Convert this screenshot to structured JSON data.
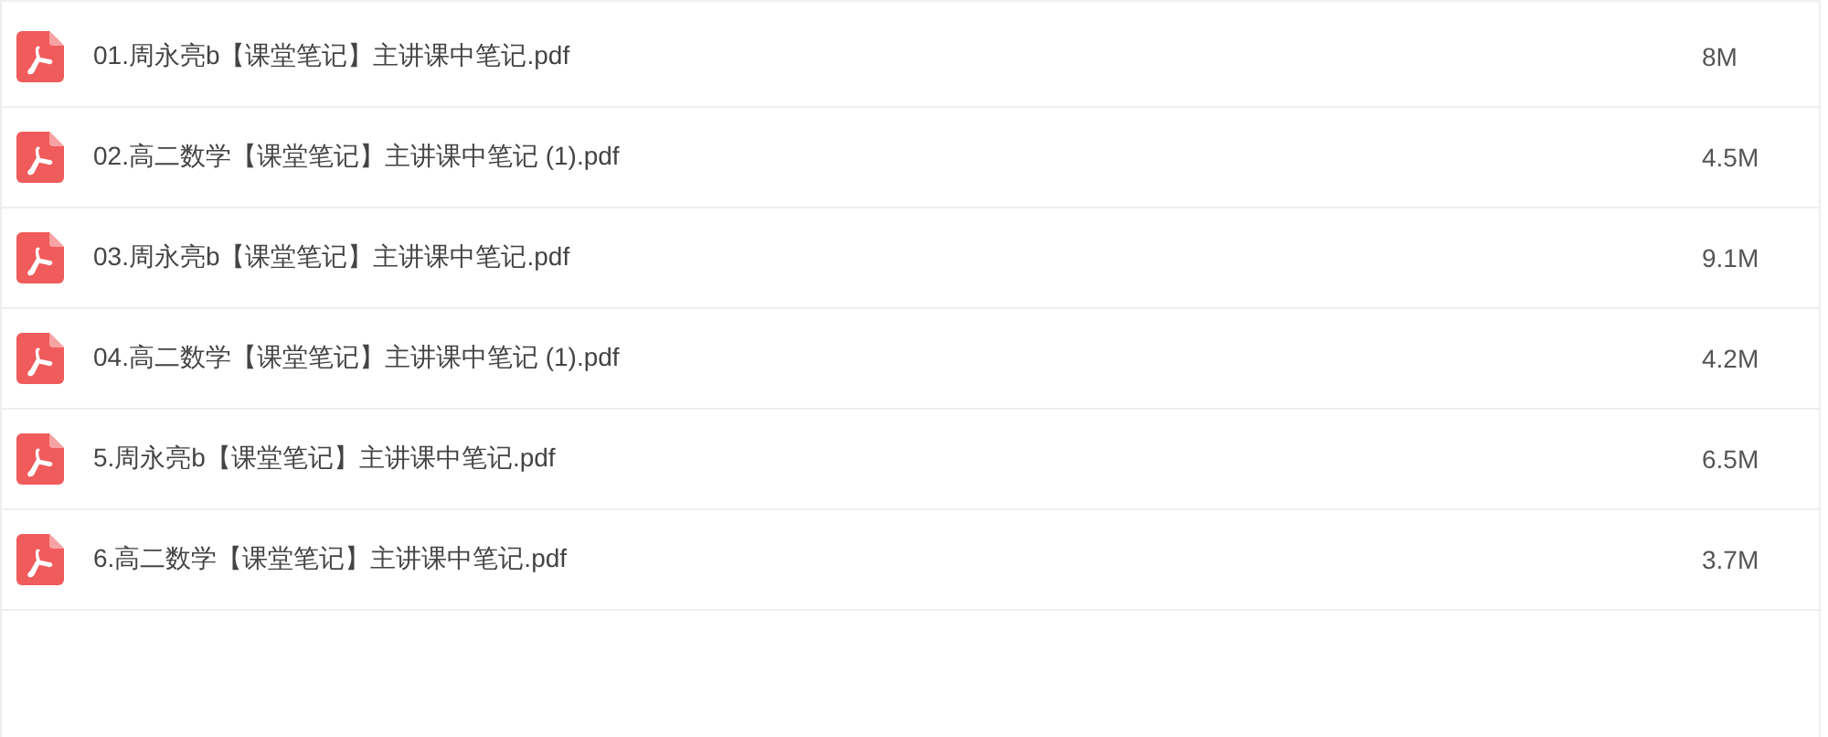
{
  "files": [
    {
      "name": "01.周永亮b【课堂笔记】主讲课中笔记.pdf",
      "size": "8M",
      "kind": "pdf"
    },
    {
      "name": "02.高二数学【课堂笔记】主讲课中笔记 (1).pdf",
      "size": "4.5M",
      "kind": "pdf"
    },
    {
      "name": "03.周永亮b【课堂笔记】主讲课中笔记.pdf",
      "size": "9.1M",
      "kind": "pdf"
    },
    {
      "name": "04.高二数学【课堂笔记】主讲课中笔记 (1).pdf",
      "size": "4.2M",
      "kind": "pdf"
    },
    {
      "name": "5.周永亮b【课堂笔记】主讲课中笔记.pdf",
      "size": "6.5M",
      "kind": "pdf"
    },
    {
      "name": "6.高二数学【课堂笔记】主讲课中笔记.pdf",
      "size": "3.7M",
      "kind": "pdf"
    }
  ]
}
